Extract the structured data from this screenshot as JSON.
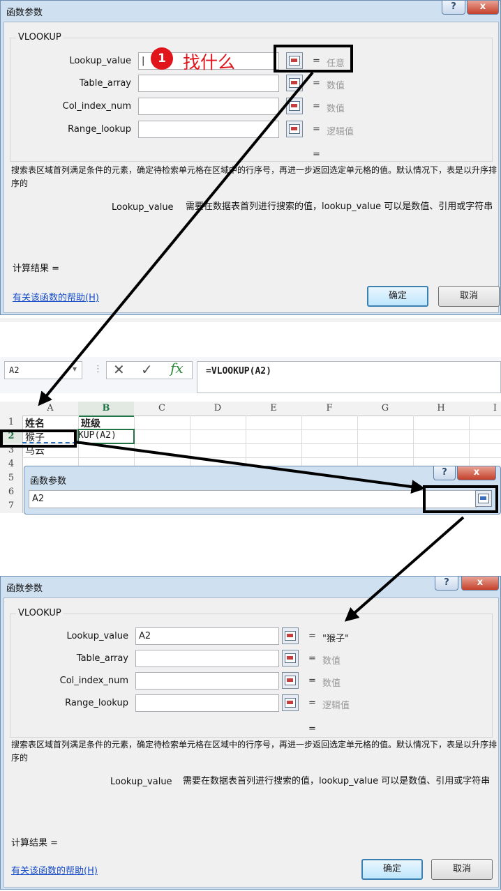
{
  "dialog_top": {
    "title": "函数参数",
    "help_label": "?",
    "close_label": "x",
    "function_name": "VLOOKUP",
    "args": [
      {
        "label": "Lookup_value",
        "value": "|",
        "result": "任意"
      },
      {
        "label": "Table_array",
        "value": "",
        "result": "数值"
      },
      {
        "label": "Col_index_num",
        "value": "",
        "result": "数值"
      },
      {
        "label": "Range_lookup",
        "value": "",
        "result": "逻辑值"
      }
    ],
    "eq": "=",
    "total_eq": "=",
    "description": "搜索表区域首列满足条件的元素，确定待检索单元格在区域中的行序号，再进一步返回选定单元格的值。默认情况下，表是以升序排序的",
    "param_name": "Lookup_value",
    "param_desc": "需要在数据表首列进行搜索的值，lookup_value 可以是数值、引用或字符串",
    "calc_result": "计算结果 =",
    "help_link": "有关该函数的帮助(H)",
    "ok_label": "确定",
    "cancel_label": "取消"
  },
  "annotation": {
    "step_number": "1",
    "step_text": "找什么",
    "step_color": "#e0151b"
  },
  "excel": {
    "name_box": "A2",
    "dropdown_glyph": "▾",
    "separator": "⋮",
    "cancel_glyph": "✕",
    "enter_glyph": "✓",
    "fx_label": "fx",
    "formula": "=VLOOKUP(A2)",
    "columns": [
      "A",
      "B",
      "C",
      "D",
      "E",
      "F",
      "G",
      "H",
      "I"
    ],
    "rows": [
      "1",
      "2",
      "3",
      "4",
      "5",
      "6",
      "7"
    ],
    "cells": {
      "a1": "姓名",
      "b1": "班级",
      "a2": "猴子",
      "b2": "KUP(A2)",
      "a3": "马云"
    },
    "mini_dialog": {
      "title": "函数参数",
      "help_label": "?",
      "close_label": "x",
      "input": "A2"
    }
  },
  "dialog_bottom": {
    "title": "函数参数",
    "help_label": "?",
    "close_label": "x",
    "function_name": "VLOOKUP",
    "args": [
      {
        "label": "Lookup_value",
        "value": "A2",
        "result": "\"猴子\""
      },
      {
        "label": "Table_array",
        "value": "",
        "result": "数值"
      },
      {
        "label": "Col_index_num",
        "value": "",
        "result": "数值"
      },
      {
        "label": "Range_lookup",
        "value": "",
        "result": "逻辑值"
      }
    ],
    "eq": "=",
    "total_eq": "=",
    "description": "搜索表区域首列满足条件的元素，确定待检索单元格在区域中的行序号，再进一步返回选定单元格的值。默认情况下，表是以升序排序的",
    "param_name": "Lookup_value",
    "param_desc": "需要在数据表首列进行搜索的值，lookup_value 可以是数值、引用或字符串",
    "calc_result": "计算结果 =",
    "help_link": "有关该函数的帮助(H)",
    "ok_label": "确定",
    "cancel_label": "取消"
  }
}
